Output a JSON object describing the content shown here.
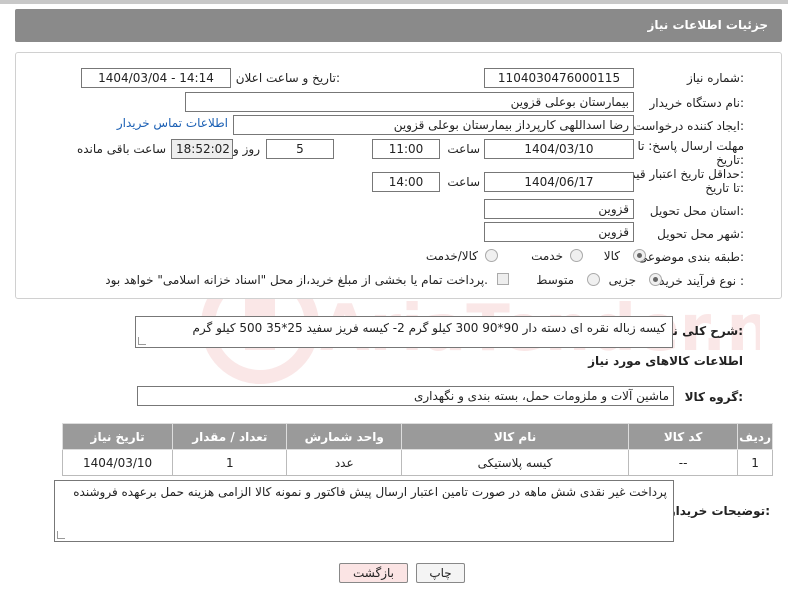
{
  "header": {
    "title": "جزئیات اطلاعات نیاز"
  },
  "fields": {
    "need_number_label": "شماره نیاز:",
    "need_number": "1104030476000115",
    "announce_label": "تاریخ و ساعت اعلان عمومی:",
    "announce_value": "1404/03/04 - 14:14",
    "buyer_org_label": "نام دستگاه خریدار:",
    "buyer_org": "بیمارستان بوعلی قزوین",
    "creator_label": "ایجاد کننده درخواست:",
    "creator": "رضا اسداللهی کارپرداز بیمارستان بوعلی قزوین",
    "contact_link": "اطلاعات تماس خریدار",
    "deadline_label_1": "مهلت ارسال پاسخ: تا",
    "deadline_label_2": "تاریخ:",
    "deadline_date": "1404/03/10",
    "time_label": "ساعت",
    "deadline_time": "11:00",
    "days_value": "5",
    "days_label": "روز و",
    "remaining_time": "18:52:02",
    "remaining_label": "ساعت باقی مانده",
    "price_validity_label_1": "حداقل تاریخ اعتبار قیمت:",
    "price_validity_label_2": "تا تاریخ:",
    "price_validity_date": "1404/06/17",
    "price_validity_time": "14:00",
    "province_label": "استان محل تحویل:",
    "province": "قزوین",
    "city_label": "شهر محل تحویل:",
    "city": "قزوین",
    "category_label": "طبقه بندی موضوعی:",
    "category_options": [
      "کالا",
      "خدمت",
      "کالا/خدمت"
    ],
    "process_label": "نوع فرآیند خرید :",
    "process_options": [
      "جزیی",
      "متوسط"
    ],
    "payment_note": "پرداخت تمام یا بخشی از مبلغ خرید،از محل \"اسناد خزانه اسلامی\" خواهد بود."
  },
  "summary": {
    "label": "شرح کلی نیاز:",
    "text": "کیسه زباله نقره ای دسته دار 90*90   300 کیلو گرم  2- کیسه فریز سفید  25*35    500 کیلو گرم"
  },
  "goods_section": {
    "title": "اطلاعات کالاهای مورد نیاز",
    "group_label": "گروه کالا:",
    "group_value": "ماشین آلات و ملزومات حمل، بسته بندی و نگهداری"
  },
  "table": {
    "headers": [
      "ردیف",
      "کد کالا",
      "نام کالا",
      "واحد شمارش",
      "تعداد / مقدار",
      "تاریخ نیاز"
    ],
    "rows": [
      [
        "1",
        "--",
        "کیسه پلاستیکی",
        "عدد",
        "1",
        "1404/03/10"
      ]
    ]
  },
  "buyer_notes": {
    "label": "توضیحات خریدار:",
    "text": "پرداخت غیر نقدی شش ماهه در صورت تامین اعتبار ارسال پیش فاکتور و نمونه کالا الزامی هزینه حمل برعهده فروشنده"
  },
  "buttons": {
    "print": "چاپ",
    "back": "بازگشت"
  },
  "watermark": {
    "text": "AriaTender.neT"
  },
  "colors": {
    "titlebar": "#8a8a8a",
    "table_header": "#9a9a9a",
    "link": "#1a5fb4",
    "back_button": "#fbe4e4"
  }
}
